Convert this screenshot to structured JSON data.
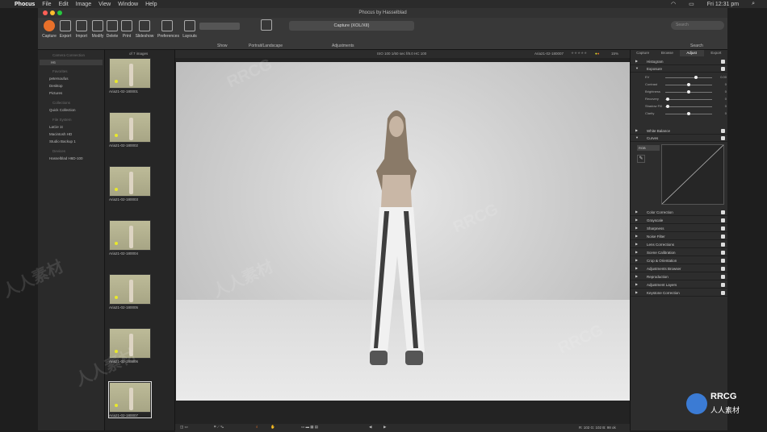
{
  "menubar": {
    "app": "Phocus",
    "items": [
      "File",
      "Edit",
      "Image",
      "View",
      "Window",
      "Help"
    ],
    "clock": "Fri 12:31 pm"
  },
  "window": {
    "title": "Phocus by Hasselblad"
  },
  "toolbar": {
    "buttons": [
      "Capture",
      "Export",
      "Import",
      "Modify",
      "Delete",
      "Print",
      "Slideshow",
      "Preferences",
      "Layouts"
    ],
    "show_label": "Show",
    "portrait_label": "Portrait/Landscape",
    "mode_value": "Capture (XOL/XII)",
    "adjustments_label": "Adjustments",
    "search_placeholder": "Search",
    "search_label": "Search"
  },
  "left_panel": {
    "items": [
      {
        "label": "Camera Connection",
        "kind": "head"
      },
      {
        "label": "H6",
        "kind": "sel"
      },
      {
        "label": "Favorites",
        "kind": "head"
      },
      {
        "label": "petersoufus",
        "kind": "item"
      },
      {
        "label": "Desktop",
        "kind": "item"
      },
      {
        "label": "Pictures",
        "kind": "item"
      },
      {
        "label": "Collections",
        "kind": "head"
      },
      {
        "label": "Quick Collection",
        "kind": "item"
      },
      {
        "label": "File System",
        "kind": "head"
      },
      {
        "label": "LaCie 1t",
        "kind": "item"
      },
      {
        "label": "Macintosh HD",
        "kind": "item"
      },
      {
        "label": "Studio Backup 1",
        "kind": "item"
      },
      {
        "label": "Devices",
        "kind": "head"
      },
      {
        "label": "Hasselblad H6D-100",
        "kind": "item"
      }
    ]
  },
  "strip": {
    "count_label": "of 7 images",
    "thumbs": [
      "Aria21-02-180001",
      "Aria21-02-180002",
      "Aria21-02-180003",
      "Aria21-02-180004",
      "Aria21-02-180005",
      "Aria21-02-180006",
      "Aria21-02-180007"
    ]
  },
  "viewer": {
    "info": "ISO 100  1/60 sec  f/8.0  HC 100",
    "filename": "Aria21-02-180007",
    "zoom": "15%",
    "readout": "R: 102  G: 102  B: 98  ok"
  },
  "right_panel": {
    "tabs": [
      "Capture",
      "Browse",
      "Adjust",
      "Export"
    ],
    "active_tab": "Adjust",
    "tools_top": [
      "Histogram",
      "Exposure"
    ],
    "exposure_sliders": [
      {
        "label": "EV",
        "value": "0.00",
        "pos": 0.65
      },
      {
        "label": "Contrast",
        "value": "0",
        "pos": 0.5
      },
      {
        "label": "Brightness",
        "value": "0",
        "pos": 0.5
      },
      {
        "label": "Recovery",
        "value": "0",
        "pos": 0.05
      },
      {
        "label": "Shadow Fill",
        "value": "0",
        "pos": 0.05
      },
      {
        "label": "Clarity",
        "value": "0",
        "pos": 0.5
      }
    ],
    "tools_mid": [
      "White Balance",
      "Curves"
    ],
    "curves_channel": "RGB",
    "tools_bottom": [
      "Color Correction",
      "Grayscale",
      "Sharpness",
      "Noise Filter",
      "Lens Corrections",
      "Scene Calibration",
      "Crop & Orientation",
      "Adjustments Browser",
      "Reproduction",
      "Adjustment Layers",
      "Keystone Correction"
    ]
  },
  "watermarks": [
    "RRCG",
    "人人素材",
    "RRCG",
    "人人素材",
    "RRCG",
    "人人素材"
  ],
  "brand": {
    "logo_text": "RRCG",
    "logo_sub": "人人素材"
  }
}
